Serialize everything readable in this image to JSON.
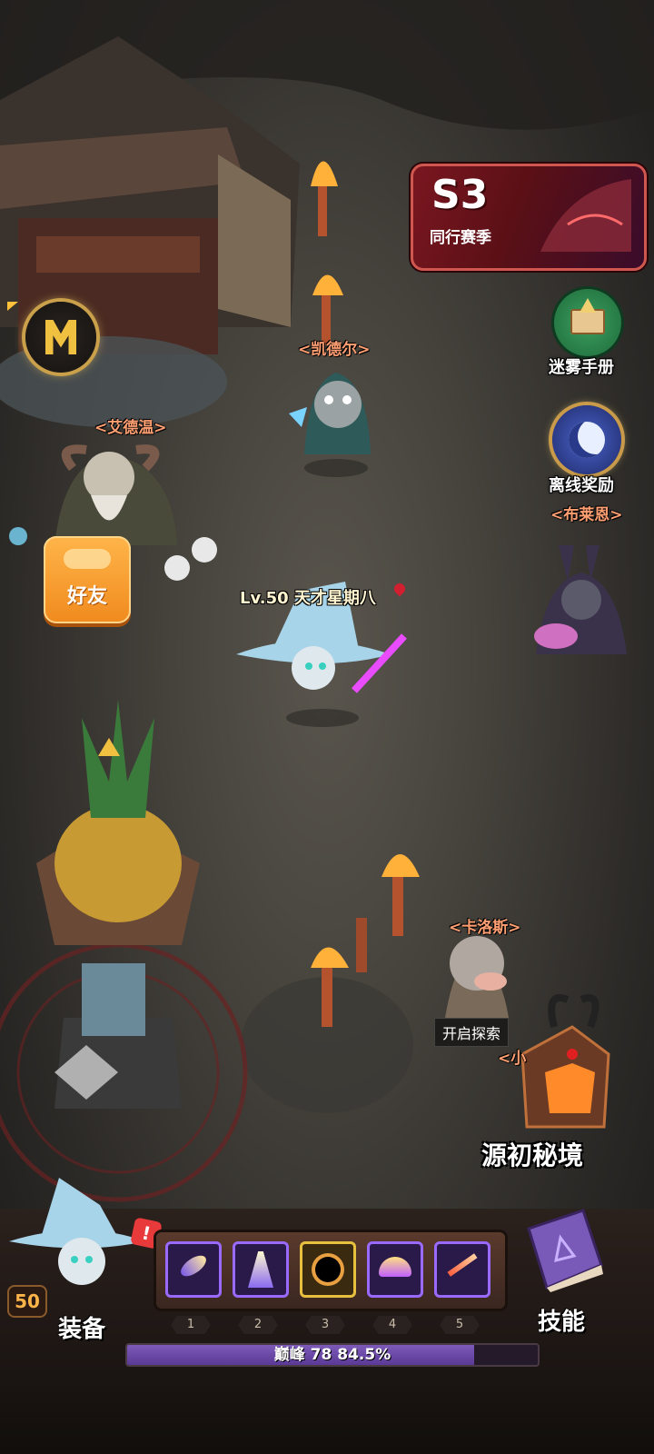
{
  "npcs": {
    "kaideer": "<凯德尔>",
    "aidewen": "<艾德温>",
    "bulaien": "<布莱恩>",
    "kaluosi": "<卡洛斯>",
    "partial": "<小"
  },
  "player": {
    "name": "Lv.50 天才星期八",
    "level_badge": "50"
  },
  "season": {
    "tag": "S3",
    "subtitle": "同行赛季"
  },
  "side_menu": {
    "handbook": "迷雾手册",
    "offline_reward": "离线奖励"
  },
  "friend_button": "好友",
  "tooltip": "开启探索",
  "portal": "源初秘境",
  "bottom": {
    "equip": "装备",
    "skills": "技能",
    "slot_numbers": [
      "1",
      "2",
      "3",
      "4",
      "5"
    ],
    "exp_text": "巅峰 78  84.5%",
    "exp_fraction": 0.845
  },
  "colors": {
    "npc_name": "#ff9f72",
    "friend_button": "#f39a2b",
    "season_border": "#d0574f",
    "skill_border": "#9a6aff"
  }
}
